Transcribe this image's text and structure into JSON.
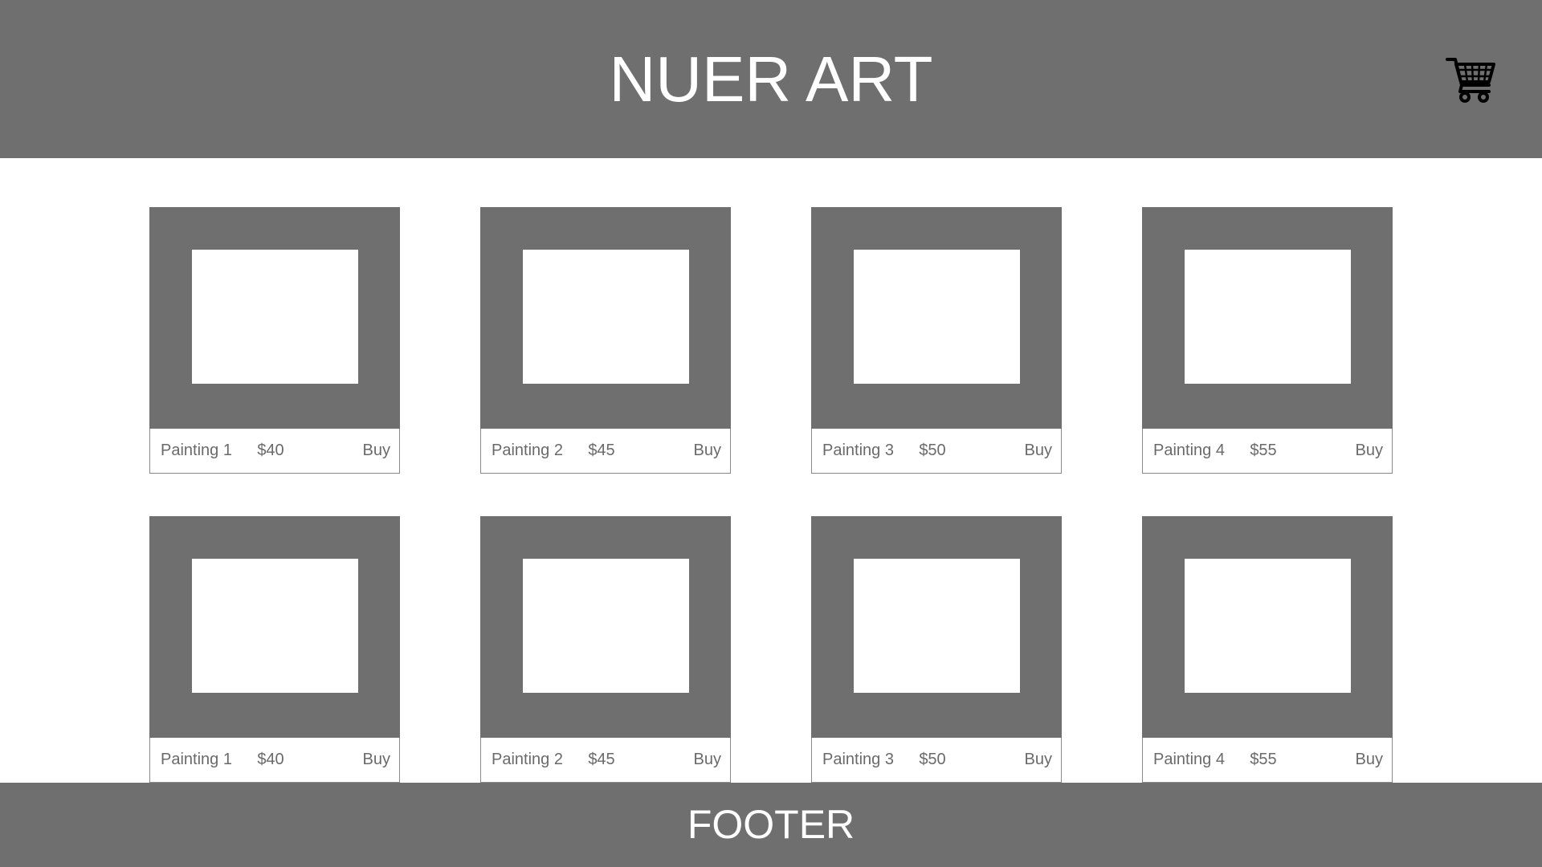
{
  "header": {
    "title": "NUER ART",
    "cart_icon": "shopping-cart-icon"
  },
  "products": [
    {
      "name": "Painting 1",
      "price": "$40",
      "buy_label": "Buy"
    },
    {
      "name": "Painting 2",
      "price": "$45",
      "buy_label": "Buy"
    },
    {
      "name": "Painting 3",
      "price": "$50",
      "buy_label": "Buy"
    },
    {
      "name": "Painting 4",
      "price": "$55",
      "buy_label": "Buy"
    },
    {
      "name": "Painting 1",
      "price": "$40",
      "buy_label": "Buy"
    },
    {
      "name": "Painting 2",
      "price": "$45",
      "buy_label": "Buy"
    },
    {
      "name": "Painting 3",
      "price": "$50",
      "buy_label": "Buy"
    },
    {
      "name": "Painting 4",
      "price": "$55",
      "buy_label": "Buy"
    }
  ],
  "footer": {
    "text": "FOOTER"
  },
  "colors": {
    "header_bg": "#6f6f6f",
    "frame_bg": "#6f6f6f",
    "footer_bg": "#6f6f6f",
    "page_bg": "#ffffff",
    "title_text": "#ffffff",
    "card_text": "#6a6a6a"
  }
}
